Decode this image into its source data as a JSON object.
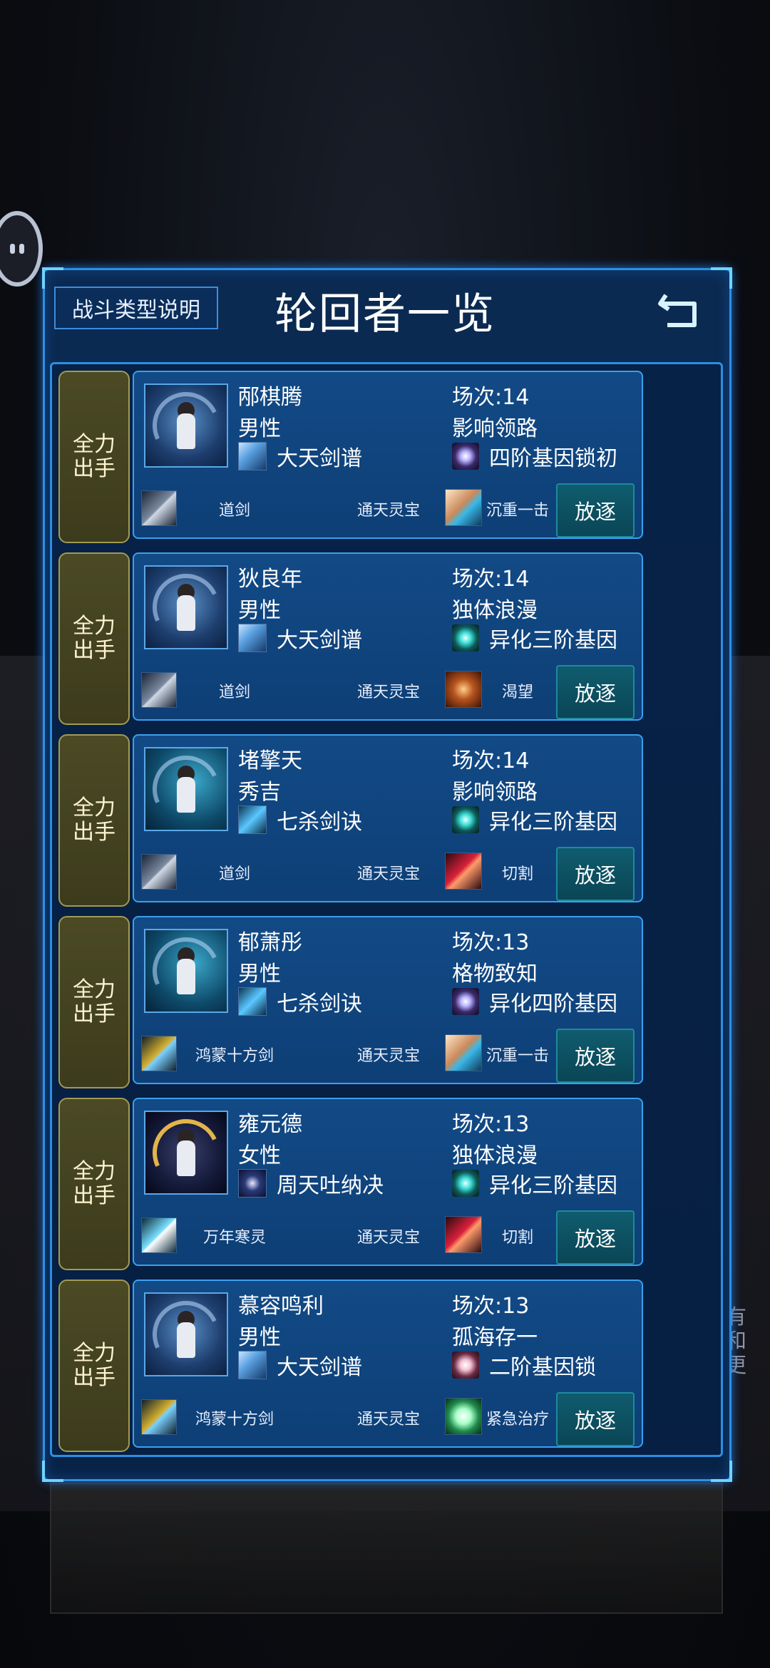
{
  "header": {
    "help_label": "战斗类型说明",
    "title": "轮回者一览"
  },
  "side_text": "有和更",
  "rows": [
    {
      "mode": "全力出手",
      "name": "邴棋腾",
      "gender": "男性",
      "skill": "大天剑谱",
      "match": "场次:14",
      "trait": "影响领路",
      "gene": "四阶基因锁初",
      "weapon": "道剑",
      "treasure": "通天灵宝",
      "ability": "沉重一击",
      "exile": "放逐"
    },
    {
      "mode": "全力出手",
      "name": "狄良年",
      "gender": "男性",
      "skill": "大天剑谱",
      "match": "场次:14",
      "trait": "独体浪漫",
      "gene": "异化三阶基因",
      "weapon": "道剑",
      "treasure": "通天灵宝",
      "ability": "渴望",
      "exile": "放逐"
    },
    {
      "mode": "全力出手",
      "name": "堵擎天",
      "gender": "秀吉",
      "skill": "七杀剑诀",
      "match": "场次:14",
      "trait": "影响领路",
      "gene": "异化三阶基因",
      "weapon": "道剑",
      "treasure": "通天灵宝",
      "ability": "切割",
      "exile": "放逐"
    },
    {
      "mode": "全力出手",
      "name": "郁萧彤",
      "gender": "男性",
      "skill": "七杀剑诀",
      "match": "场次:13",
      "trait": "格物致知",
      "gene": "异化四阶基因",
      "weapon": "鸿蒙十方剑",
      "treasure": "通天灵宝",
      "ability": "沉重一击",
      "exile": "放逐"
    },
    {
      "mode": "全力出手",
      "name": "雍元德",
      "gender": "女性",
      "skill": "周天吐纳决",
      "match": "场次:13",
      "trait": "独体浪漫",
      "gene": "异化三阶基因",
      "weapon": "万年寒灵",
      "treasure": "通天灵宝",
      "ability": "切割",
      "exile": "放逐"
    },
    {
      "mode": "全力出手",
      "name": "慕容鸣利",
      "gender": "男性",
      "skill": "大天剑谱",
      "match": "场次:13",
      "trait": "孤海存一",
      "gene": "二阶基因锁",
      "weapon": "鸿蒙十方剑",
      "treasure": "通天灵宝",
      "ability": "紧急治疗",
      "exile": "放逐"
    }
  ]
}
